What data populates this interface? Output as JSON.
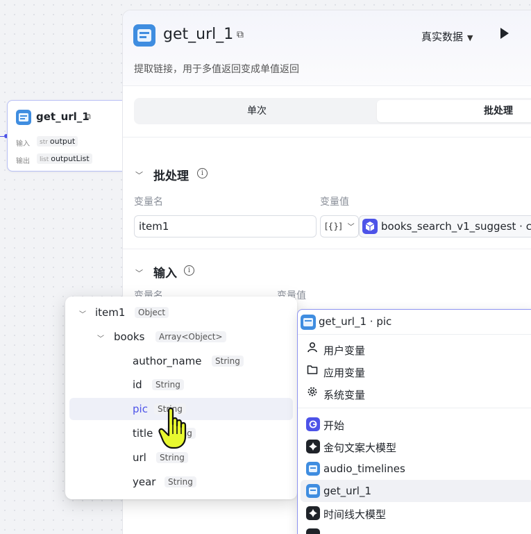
{
  "node": {
    "title": "get_url_1",
    "input_label": "输入",
    "input_type": "str",
    "input_value": "output",
    "output_label": "输出",
    "output_type": "list",
    "output_value": "outputList"
  },
  "panel": {
    "title": "get_url_1",
    "mode": "真实数据",
    "description": "提取链接，用于多值返回变成单值返回",
    "tabs": [
      "单次",
      "批处理"
    ],
    "active_tab": "批处理"
  },
  "batch": {
    "title": "批处理",
    "col_name": "变量名",
    "col_value": "变量值",
    "var_name": "item1",
    "type_value": "[{}]",
    "ref_value": "books_search_v1_suggest · c"
  },
  "inputs": {
    "title": "输入",
    "col_name": "变量名",
    "col_value": "变量值",
    "selected_ref": "get_url_1 · pic"
  },
  "tree": {
    "items": [
      {
        "name": "item1",
        "type": "Object"
      },
      {
        "name": "books",
        "type": "Array<Object>"
      },
      {
        "name": "author_name",
        "type": "String"
      },
      {
        "name": "id",
        "type": "String"
      },
      {
        "name": "pic",
        "type": "String"
      },
      {
        "name": "title",
        "type": "String"
      },
      {
        "name": "url",
        "type": "String"
      },
      {
        "name": "year",
        "type": "String"
      }
    ]
  },
  "varlist": {
    "groups": [
      "用户变量",
      "应用变量",
      "系统变量"
    ],
    "nodes": [
      "开始",
      "金句文案大模型",
      "audio_timelines",
      "get_url_1",
      "时间线大模型"
    ]
  },
  "colors": {
    "accent": "#4d53e8",
    "highlight_row": "#eef0f8"
  }
}
